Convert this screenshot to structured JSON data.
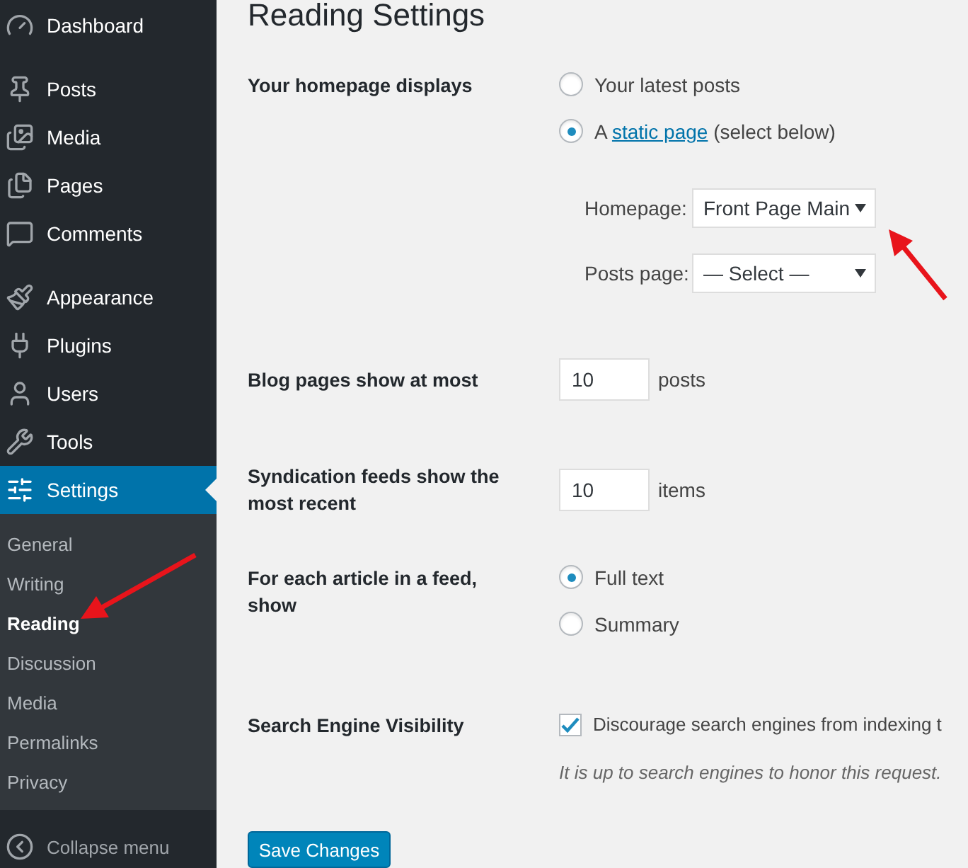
{
  "sidebar": {
    "groups": [
      {
        "items": [
          {
            "label": "Dashboard",
            "selected": false
          }
        ]
      },
      {
        "items": [
          {
            "label": "Posts",
            "selected": false
          },
          {
            "label": "Media",
            "selected": false
          },
          {
            "label": "Pages",
            "selected": false
          },
          {
            "label": "Comments",
            "selected": false
          }
        ]
      },
      {
        "items": [
          {
            "label": "Appearance",
            "selected": false
          },
          {
            "label": "Plugins",
            "selected": false
          },
          {
            "label": "Users",
            "selected": false
          },
          {
            "label": "Tools",
            "selected": false
          },
          {
            "label": "Settings",
            "selected": true,
            "children": [
              {
                "label": "General",
                "selected": false
              },
              {
                "label": "Writing",
                "selected": false
              },
              {
                "label": "Reading",
                "selected": true
              },
              {
                "label": "Discussion",
                "selected": false
              },
              {
                "label": "Media",
                "selected": false
              },
              {
                "label": "Permalinks",
                "selected": false
              },
              {
                "label": "Privacy",
                "selected": false
              }
            ]
          }
        ]
      }
    ],
    "collapse": "Collapse menu"
  },
  "page": {
    "title": "Reading Settings",
    "rows": [
      {
        "kind": "radio_group",
        "label": "Your homepage displays",
        "options": [
          {
            "label": "Your latest posts",
            "selected": false
          },
          {
            "label": "A",
            "link": "static page",
            "suffix": "(select below)",
            "selected": true
          }
        ],
        "selects": [
          {
            "label": "Homepage:",
            "value": "Front Page Main"
          },
          {
            "label": "Posts page:",
            "value": "— Select —"
          }
        ]
      },
      {
        "kind": "number",
        "label": "Blog pages show at most",
        "value": "10",
        "unit": "posts"
      },
      {
        "kind": "number",
        "label": "Syndication feeds show the most recent",
        "value": "10",
        "unit": "items"
      },
      {
        "kind": "radio_group",
        "label": "For each article in a feed, show",
        "options": [
          {
            "label": "Full text",
            "selected": true
          },
          {
            "label": "Summary",
            "selected": false
          }
        ]
      },
      {
        "kind": "checkbox",
        "label": "Search Engine Visibility",
        "text": "Discourage search engines from indexing t",
        "checked": true,
        "description": "It is up to search engines to honor this request."
      }
    ],
    "button": "Save Changes"
  }
}
